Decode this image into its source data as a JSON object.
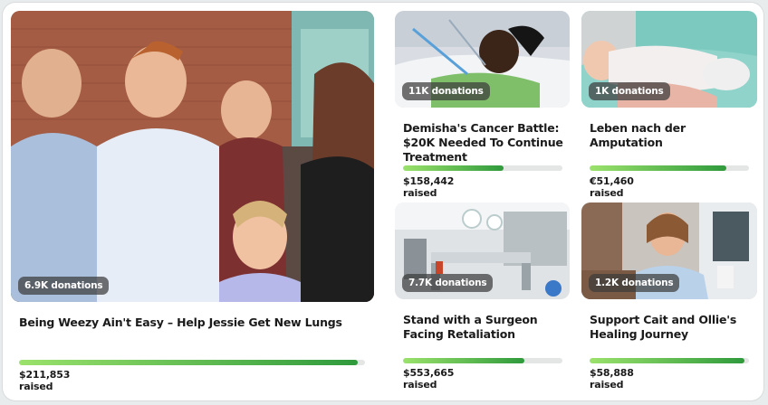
{
  "fundraisers": [
    {
      "donations_badge": "6.9K donations",
      "title": "Being Weezy Ain't Easy – Help Jessie Get New Lungs",
      "raised": "$211,853 raised",
      "progress": 0.98
    },
    {
      "donations_badge": "11K donations",
      "title": "Demisha's Cancer Battle: $20K Needed To Continue Treatment",
      "raised": "$158,442 raised",
      "progress": 0.63
    },
    {
      "donations_badge": "1K donations",
      "title": "Leben nach der Amputation",
      "raised": "€51,460 raised",
      "progress": 0.86
    },
    {
      "donations_badge": "7.7K donations",
      "title": "Stand with a Surgeon Facing Retaliation",
      "raised": "$553,665 raised",
      "progress": 0.76
    },
    {
      "donations_badge": "1.2K donations",
      "title": "Support Cait and Ollie's Healing Journey",
      "raised": "$58,888 raised",
      "progress": 0.97
    }
  ],
  "colors": {
    "progress_start": "#9be26c",
    "progress_end": "#2f9a3c",
    "track": "#e4e6e6",
    "text": "#1b1b1b"
  }
}
